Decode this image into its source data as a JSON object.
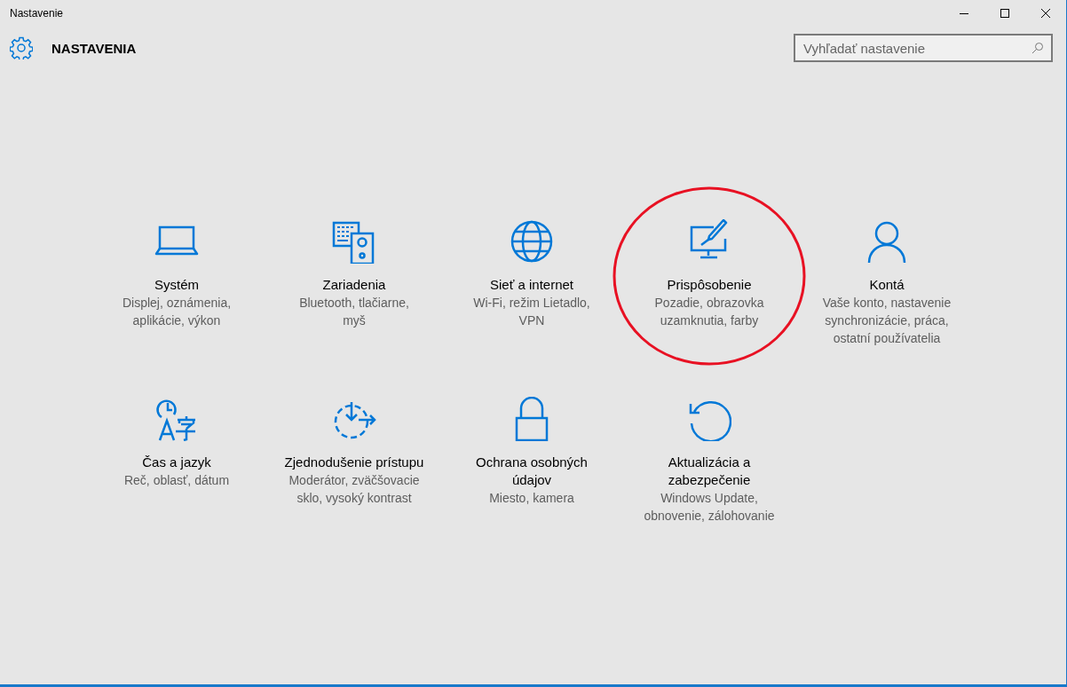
{
  "window": {
    "title": "Nastavenie"
  },
  "header": {
    "title": "NASTAVENIA"
  },
  "search": {
    "placeholder": "Vyhľadať nastavenie"
  },
  "tiles": [
    {
      "title": "Systém",
      "subtitle": "Displej, oznámenia, aplikácie, výkon",
      "circled": false
    },
    {
      "title": "Zariadenia",
      "subtitle": "Bluetooth, tlačiarne, myš",
      "circled": false
    },
    {
      "title": "Sieť a internet",
      "subtitle": "Wi-Fi, režim Lietadlo, VPN",
      "circled": false
    },
    {
      "title": "Prispôsobenie",
      "subtitle": "Pozadie, obrazovka uzamknutia, farby",
      "circled": true
    },
    {
      "title": "Kontá",
      "subtitle": "Vaše konto, nastavenie synchronizácie, práca, ostatní používatelia",
      "circled": false
    },
    {
      "title": "Čas a jazyk",
      "subtitle": "Reč, oblasť, dátum",
      "circled": false
    },
    {
      "title": "Zjednodušenie prístupu",
      "subtitle": "Moderátor, zväčšovacie sklo, vysoký kontrast",
      "circled": false
    },
    {
      "title": "Ochrana osobných údajov",
      "subtitle": "Miesto, kamera",
      "circled": false
    },
    {
      "title": "Aktualizácia a zabezpečenie",
      "subtitle": "Windows Update, obnovenie, zálohovanie",
      "circled": false
    }
  ]
}
